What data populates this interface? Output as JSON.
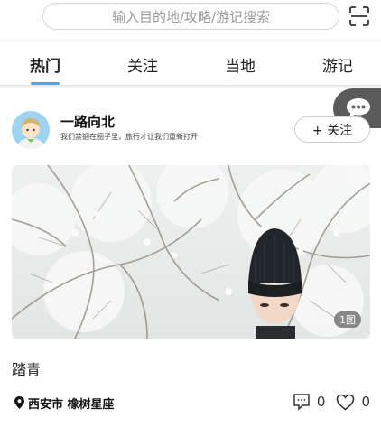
{
  "search": {
    "placeholder": "输入目的地/攻略/游记搜索"
  },
  "tabs": [
    {
      "label": "热门"
    },
    {
      "label": "关注"
    },
    {
      "label": "当地"
    },
    {
      "label": "游记"
    }
  ],
  "colors": {
    "accent": "#41a9f5",
    "float_bubble": "#5b5b5b"
  },
  "icons": {
    "scan": "scan-icon",
    "message": "message-icon",
    "location": "location-pin-icon",
    "comment": "comment-icon",
    "like": "heart-icon"
  },
  "post": {
    "author_name": "一路向北",
    "author_bio": "我们禁锢在圈子里，旅行才让我们重新打开",
    "follow_label": "+ 关注",
    "image_count": "1图",
    "title": "踏青",
    "location": "西安市 橡树星座",
    "comments": "0",
    "likes": "0"
  }
}
